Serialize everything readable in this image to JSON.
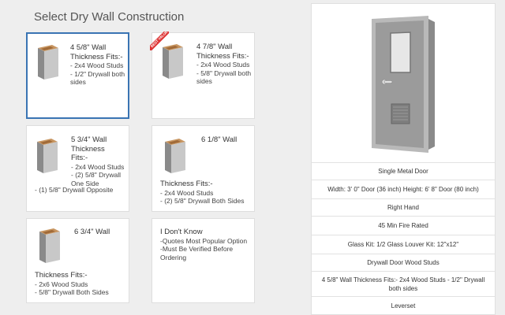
{
  "header": {
    "title": "Select Dry Wall Construction"
  },
  "options": [
    {
      "title": "4 5/8\" Wall Thickness Fits:-",
      "lines": [
        "- 2x4 Wood Studs",
        "- 1/2\" Drywall both sides"
      ]
    },
    {
      "title": "4 7/8\" Wall Thickness Fits:-",
      "lines": [
        "- 2x4 Wood Studs",
        "- 5/8\" Drywall both sides"
      ],
      "badge": "BEST VALUE"
    },
    {
      "title": "5 3/4\" Wall Thickness Fits:-",
      "lines": [
        "- 2x4 Wood Studs",
        "- (2) 5/8\" Drywall One Side",
        "- (1) 5/8\" Drywall Opposite"
      ]
    },
    {
      "title": "6 1/8\" Wall",
      "subtitle": "Thickness Fits:-",
      "lines": [
        "- 2x4 Wood Studs",
        "- (2) 5/8\" Drywall Both Sides"
      ]
    },
    {
      "title": "6 3/4\" Wall",
      "subtitle": "Thickness Fits:-",
      "lines": [
        "- 2x6 Wood Studs",
        "- 5/8\" Drywall Both Sides"
      ]
    },
    {
      "title": "I Don't Know",
      "lines": [
        "-Quotes Most Popular Option",
        "-Must Be Verified Before Ordering"
      ]
    }
  ],
  "specs": [
    "Single Metal Door",
    "Width: 3' 0\" Door (36 inch)   Height: 6' 8\" Door (80 inch)",
    "Right Hand",
    "45 Min Fire Rated",
    "Glass Kit: 1/2 Glass   Louver Kit: 12\"x12\"",
    "Drywall Door Wood Studs",
    "4 5/8\" Wall Thickness Fits:- 2x4 Wood Studs - 1/2\" Drywall both sides",
    "Leverset"
  ],
  "colors": {
    "accent": "#3a74b3",
    "door": "#9a9a9a",
    "frame": "#b7b7b7",
    "wood": "#b5804a",
    "badge": "#dd3333"
  }
}
